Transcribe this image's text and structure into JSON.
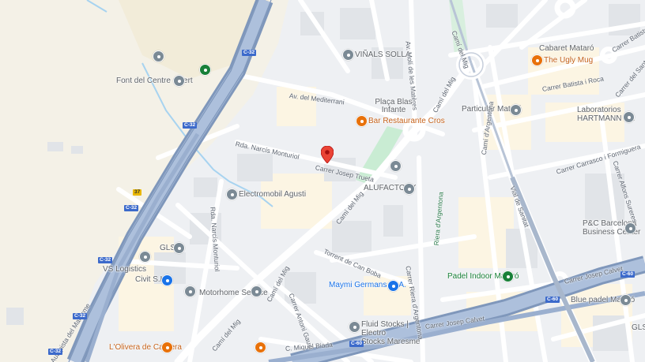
{
  "map": {
    "pois": {
      "vinals_solla": "VIÑALS SOLLA",
      "font_centre_obert": "Font del Centre Obert",
      "placa_blas": "Plaça Blas\nInfante",
      "bar_cros": "Bar Restaurante Cros",
      "alufactory": "ALUFACTORY",
      "electromobil": "Electromobil Agusti",
      "gls": "GLS",
      "vs_logistics": "VS Logistics",
      "civit": "Civit S.L.",
      "motorhome": "Motorhome Service",
      "maymi": "Maymi Germans, S.A.",
      "fluid_stocks": "Fluid Stocks | Electro\nStocks Maresme",
      "lolivera": "L'Olivera de Cabrera",
      "cabaret": "Cabaret Mataró",
      "ugly_mug": "The Ugly Mug",
      "particular": "Particular Mataró",
      "hartmann": "Laboratorios\nHARTMANN SA",
      "pb_business": "P&C Barcelona\nBusiness Center",
      "padel_indoor": "Padel Indoor Mataró",
      "blue_padel": "Blue padel Mataró",
      "gls_right": "GLS"
    },
    "roads": {
      "av_mediterrani": "Av. del Mediterrani",
      "narcis_1": "Rda. Narcís Monturiol",
      "narcis_2": "Rda. Narcís Monturiol",
      "josep_trueta": "Carrer Josep Trueta",
      "cami_mig_1": "Camí del Mig",
      "cami_mig_2": "Camí del Mig",
      "cami_mig_3": "Camí del Mig",
      "cami_mig_4": "Camí del Mig",
      "torrent": "Torrent de Can Boba",
      "antoni_gaudi": "Carrer Antoni Gaudí",
      "miquel_biada": "C. Miquel Biada",
      "riera_argentona": "Carrer Riera d'Argentona",
      "riera_green": "Riera d'Argentona",
      "josep_calvet_1": "Carrer Josep Calvet",
      "josep_calvet_2": "Carrer Josep Calvet",
      "av_moli": "Av. Molí de les Matères",
      "batista_roca": "Carrer Batista i Roca",
      "batista_top": "Carrer Batiste",
      "sant_crist": "Carrer del Sant Crist",
      "carrasco": "Carrer Carrasco i Formiguera",
      "alfons": "Carrer Alfons Sureres",
      "cami_mig_r": "Camí del Mig",
      "vial_sanitat": "Vial de Sanitat",
      "cami_argentona": "Camí d'Argentona",
      "ar_maresme": "Autopista del Maresme"
    },
    "shields": [
      "C-32",
      "C-32",
      "C-32",
      "C-32",
      "C-32",
      "C-32",
      "C-60",
      "C-60",
      "C-60",
      "37"
    ]
  }
}
